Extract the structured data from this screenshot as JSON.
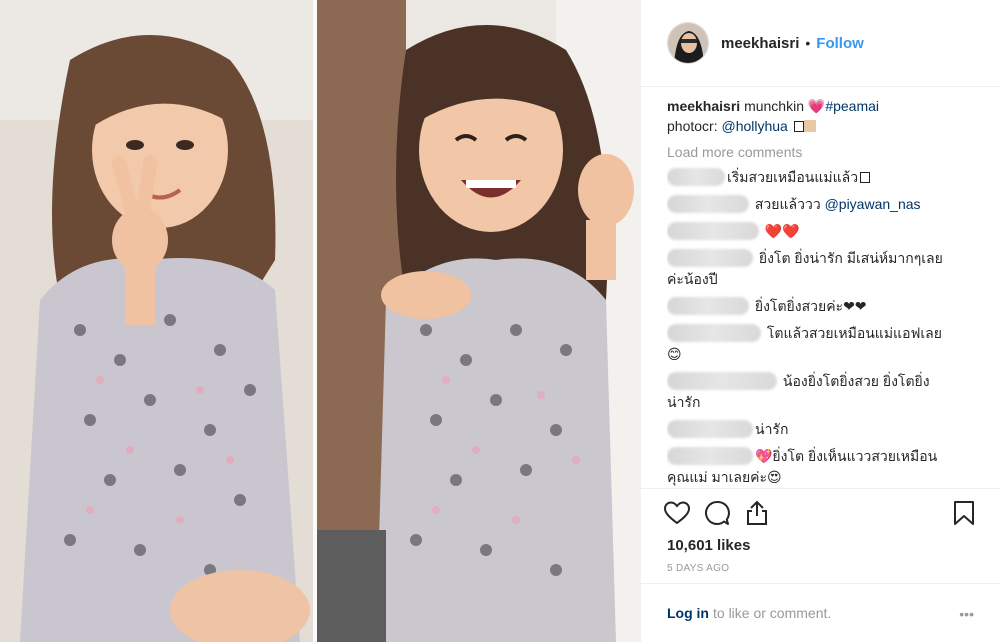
{
  "post": {
    "username": "meekhaisri",
    "header_dot": "•",
    "follow_label": "Follow"
  },
  "caption": {
    "username": "meekhaisri",
    "text": "munchkin",
    "heart_emoji": "💗",
    "hashtag": "#peamai",
    "credit_prefix": "photocr:",
    "credit_handle": "@hollyhua"
  },
  "load_more_label": "Load more comments",
  "comments": [
    {
      "text": "เริ่มสวยเหมือนแม่แล้ว"
    },
    {
      "text": "สวยแล้ววว",
      "mention": "@piyawan_nas"
    },
    {
      "text": "❤️❤️"
    },
    {
      "text": "ยิ่งโต ยิ่งน่ารัก มีเสน่ห์มากๆเลย",
      "line2": "ค่ะน้องปี"
    },
    {
      "text": "ยิ่งโตยิ่งสวยค่ะ❤❤"
    },
    {
      "text": "โตแล้วสวยเหมือนแม่แอฟเลย",
      "line2": "😊"
    },
    {
      "text": "น้องยิ่งโตยิ่งสวย ยิ่งโตยิ่ง",
      "line2": "น่ารัก"
    },
    {
      "text": "น่ารัก"
    },
    {
      "text": "💖ยิ่งโต ยิ่งเห็นแววสวยเหมือน",
      "line2": "คุณแม่ มาเลยค่ะ😍"
    }
  ],
  "actions": {
    "likes": "10,601 likes",
    "date": "5 DAYS AGO"
  },
  "login": {
    "link": "Log in",
    "rest": "to like or comment.",
    "more": "•••"
  }
}
